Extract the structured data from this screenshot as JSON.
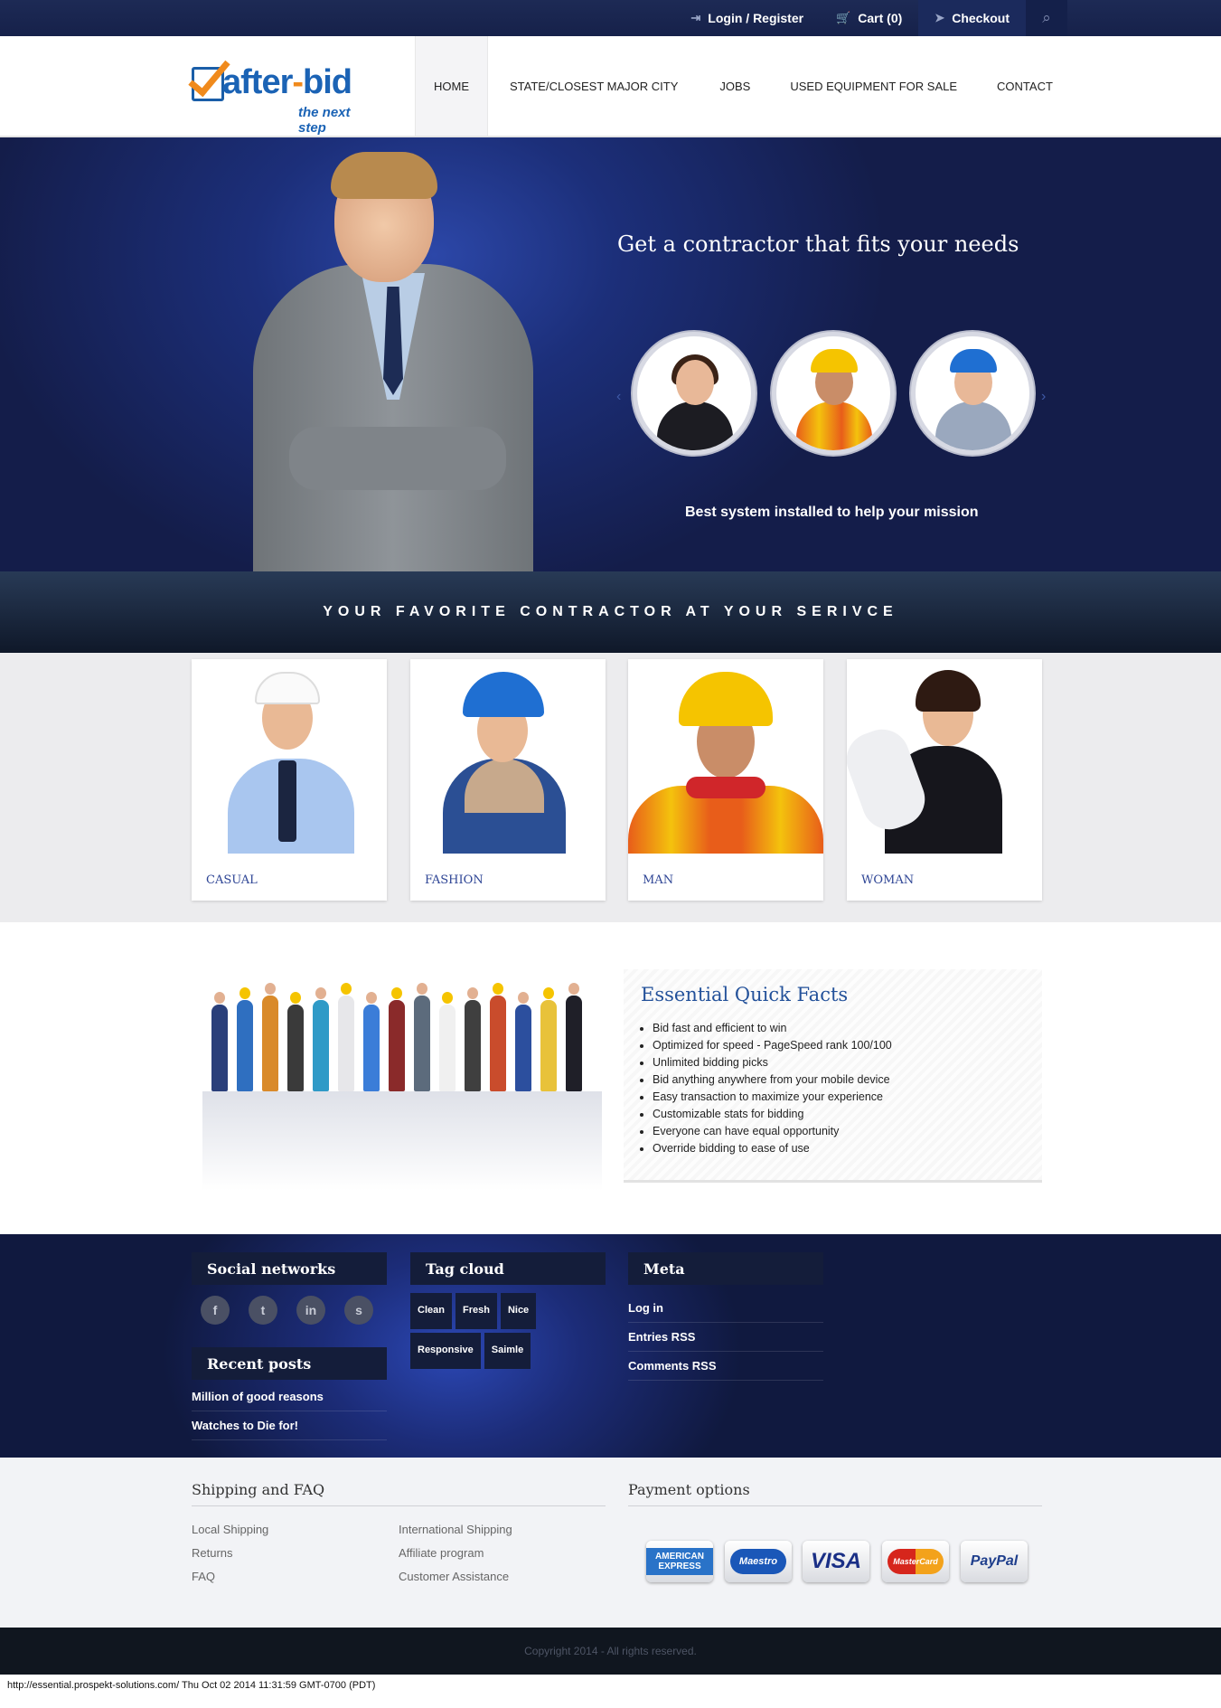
{
  "topbar": {
    "login": "Login / Register",
    "cart": "Cart (0)",
    "checkout": "Checkout"
  },
  "logo": {
    "name_a": "after",
    "name_dash": "-",
    "name_b": "bid",
    "tagline": "the next step"
  },
  "nav": [
    "HOME",
    "STATE/CLOSEST MAJOR CITY",
    "JOBS",
    "USED EQUIPMENT FOR SALE",
    "CONTACT"
  ],
  "hero": {
    "title": "Get a contractor that fits your needs",
    "subtitle": "Best system installed to help your mission"
  },
  "strip": {
    "text": "YOUR FAVORITE CONTRACTOR AT YOUR SERIVCE"
  },
  "categories": [
    "CASUAL",
    "FASHION",
    "MAN",
    "WOMAN"
  ],
  "facts": {
    "title": "Essential Quick Facts",
    "items": [
      "Bid fast and efficient to win",
      "Optimized for speed - PageSpeed rank 100/100",
      "Unlimited bidding picks",
      "Bid anything anywhere from your mobile device",
      "Easy transaction to maximize your experience",
      "Customizable stats for bidding",
      "Everyone can have equal opportunity",
      "Override bidding to ease of use"
    ]
  },
  "widgets": {
    "social_title": "Social networks",
    "social": [
      "f",
      "t",
      "in",
      "s"
    ],
    "recent_title": "Recent posts",
    "recent": [
      "Million of good reasons",
      "Watches to Die for!"
    ],
    "tag_title": "Tag cloud",
    "tags": [
      "Clean",
      "Fresh",
      "Nice",
      "Responsive",
      "Saimle"
    ],
    "meta_title": "Meta",
    "meta": [
      "Log in",
      "Entries RSS",
      "Comments RSS"
    ]
  },
  "shipping": {
    "title": "Shipping and FAQ",
    "col1": [
      "Local Shipping",
      "Returns",
      "FAQ"
    ],
    "col2": [
      "International Shipping",
      "Affiliate program",
      "Customer Assistance"
    ]
  },
  "payment": {
    "title": "Payment options",
    "cards": [
      "AMERICAN EXPRESS",
      "Maestro",
      "VISA",
      "MasterCard",
      "PayPal"
    ]
  },
  "copyright": "Copyright 2014 - All rights reserved.",
  "status_bar": "http://essential.prospekt-solutions.com/ Thu Oct 02 2014 11:31:59 GMT-0700 (PDT)",
  "colors": {
    "brand_blue": "#1b63b5",
    "brand_orange": "#f08a1c",
    "accent_link": "#2e4595"
  }
}
